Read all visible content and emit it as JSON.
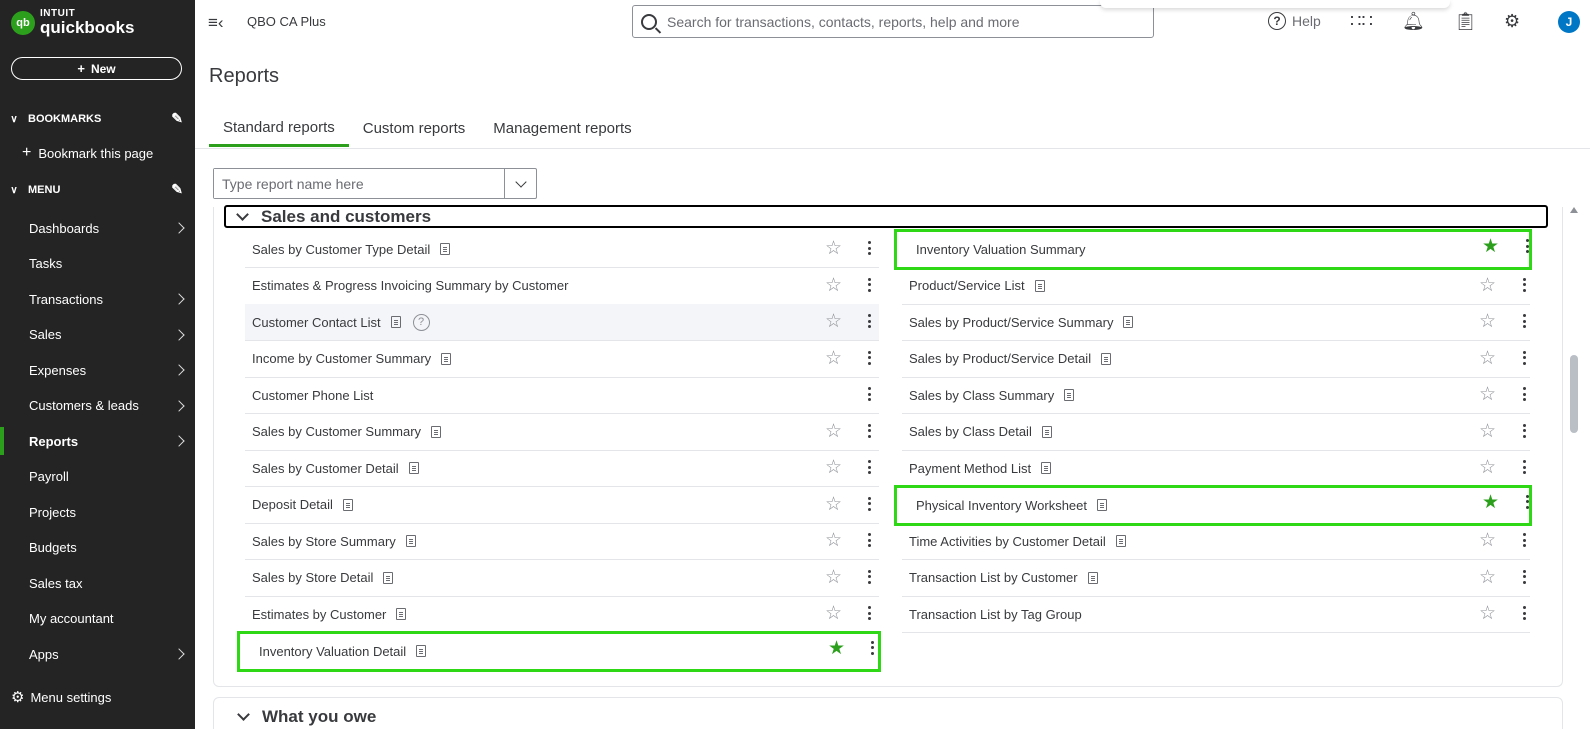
{
  "brand": {
    "line1": "INTUIT",
    "line2": "quickbooks",
    "mark": "qb"
  },
  "sidebar": {
    "new_label": "New",
    "bookmarks_label": "BOOKMARKS",
    "bookmark_this_label": "Bookmark this page",
    "menu_label": "MENU",
    "items": [
      {
        "label": "Dashboards",
        "has_arrow": true
      },
      {
        "label": "Tasks",
        "has_arrow": false
      },
      {
        "label": "Transactions",
        "has_arrow": true
      },
      {
        "label": "Sales",
        "has_arrow": true
      },
      {
        "label": "Expenses",
        "has_arrow": true
      },
      {
        "label": "Customers & leads",
        "has_arrow": true
      },
      {
        "label": "Reports",
        "has_arrow": true,
        "active": true
      },
      {
        "label": "Payroll",
        "has_arrow": false
      },
      {
        "label": "Projects",
        "has_arrow": false
      },
      {
        "label": "Budgets",
        "has_arrow": false
      },
      {
        "label": "Sales tax",
        "has_arrow": false
      },
      {
        "label": "My accountant",
        "has_arrow": false
      },
      {
        "label": "Apps",
        "has_arrow": true
      }
    ],
    "menu_settings_label": "Menu settings"
  },
  "header": {
    "company": "QBO CA Plus",
    "search_placeholder": "Search for transactions, contacts, reports, help and more",
    "help_label": "Help",
    "avatar_initial": "J"
  },
  "page": {
    "title": "Reports",
    "tabs": [
      "Standard reports",
      "Custom reports",
      "Management reports"
    ],
    "active_tab": "Standard reports",
    "report_search_placeholder": "Type report name here"
  },
  "section": {
    "title": "Sales and customers",
    "left": [
      {
        "name": "Sales by Customer Type Detail",
        "doc": true,
        "star": "outline"
      },
      {
        "name": "Estimates & Progress Invoicing Summary by Customer",
        "doc": false,
        "star": "outline"
      },
      {
        "name": "Customer Contact List",
        "doc": true,
        "help": true,
        "star": "outline",
        "hover": true
      },
      {
        "name": "Income by Customer Summary",
        "doc": true,
        "star": "outline"
      },
      {
        "name": "Customer Phone List",
        "doc": false,
        "star": "none"
      },
      {
        "name": "Sales by Customer Summary",
        "doc": true,
        "star": "outline"
      },
      {
        "name": "Sales by Customer Detail",
        "doc": true,
        "star": "outline"
      },
      {
        "name": "Deposit Detail",
        "doc": true,
        "star": "outline"
      },
      {
        "name": "Sales by Store Summary",
        "doc": true,
        "star": "outline"
      },
      {
        "name": "Sales by Store Detail",
        "doc": true,
        "star": "outline"
      },
      {
        "name": "Estimates by Customer",
        "doc": true,
        "star": "outline"
      },
      {
        "name": "Inventory Valuation Detail",
        "doc": true,
        "star": "filled",
        "highlight": true
      }
    ],
    "right": [
      {
        "name": "Inventory Valuation Summary",
        "doc": false,
        "star": "filled",
        "highlight": true
      },
      {
        "name": "Product/Service List",
        "doc": true,
        "star": "outline"
      },
      {
        "name": "Sales by Product/Service Summary",
        "doc": true,
        "star": "outline"
      },
      {
        "name": "Sales by Product/Service Detail",
        "doc": true,
        "star": "outline"
      },
      {
        "name": "Sales by Class Summary",
        "doc": true,
        "star": "outline"
      },
      {
        "name": "Sales by Class Detail",
        "doc": true,
        "star": "outline"
      },
      {
        "name": "Payment Method List",
        "doc": true,
        "star": "outline"
      },
      {
        "name": "Physical Inventory Worksheet",
        "doc": true,
        "star": "filled",
        "highlight": true
      },
      {
        "name": "Time Activities by Customer Detail",
        "doc": true,
        "star": "outline"
      },
      {
        "name": "Transaction List by Customer",
        "doc": true,
        "star": "outline"
      },
      {
        "name": "Transaction List by Tag Group",
        "doc": false,
        "star": "outline"
      }
    ]
  },
  "section2": {
    "title": "What you owe"
  },
  "colors": {
    "brand_green": "#2ca01c",
    "highlight_green": "#2ed815",
    "sidebar_bg": "#242424",
    "avatar_blue": "#0077c5"
  }
}
